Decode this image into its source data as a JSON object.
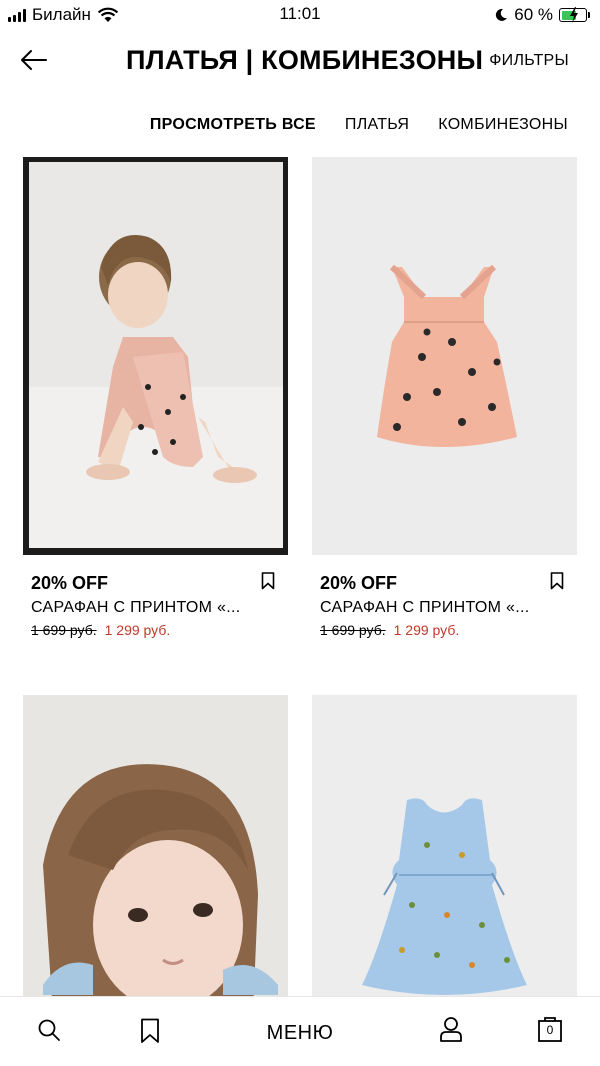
{
  "status_bar": {
    "carrier": "Билайн",
    "time": "11:01",
    "battery": "60 %"
  },
  "header": {
    "title": "ПЛАТЬЯ | КОМБИНЕЗОНЫ",
    "filters": "ФИЛЬТРЫ"
  },
  "tabs": [
    {
      "label": "ПРОСМОТРЕТЬ ВСЕ",
      "active": true
    },
    {
      "label": "ПЛАТЬЯ",
      "active": false
    },
    {
      "label": "КОМБИНЕЗОНЫ",
      "active": false
    }
  ],
  "products": [
    {
      "discount": "20% OFF",
      "name": "САРАФАН С ПРИНТОМ «...",
      "old_price": "1 699 руб.",
      "new_price": "1 299 руб."
    },
    {
      "discount": "20% OFF",
      "name": "САРАФАН С ПРИНТОМ «...",
      "old_price": "1 699 руб.",
      "new_price": "1 299 руб."
    },
    {},
    {}
  ],
  "bottom_nav": {
    "menu": "МЕНЮ",
    "cart_count": "0"
  },
  "icons": [
    "signal-icon",
    "wifi-icon",
    "moon-icon",
    "battery-icon",
    "back-arrow-icon",
    "bookmark-icon",
    "search-icon",
    "user-icon",
    "cart-icon"
  ],
  "colors": {
    "sale_price": "#c0392b",
    "battery_fill": "#35c759"
  }
}
